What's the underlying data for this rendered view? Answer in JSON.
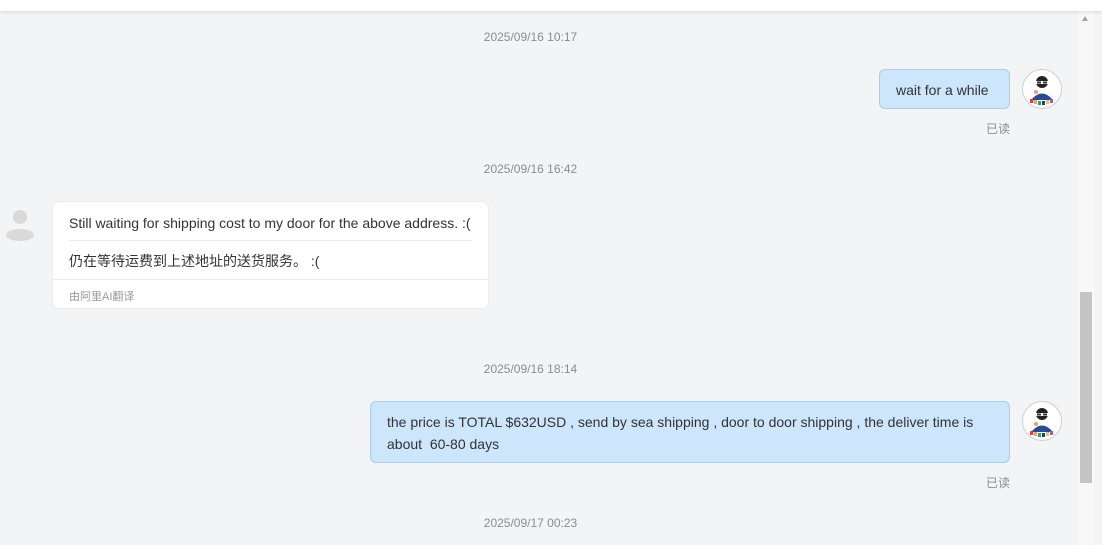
{
  "conversation": {
    "messages": [
      {
        "timestamp": "2025/09/16 10:17",
        "direction": "outgoing",
        "text": "wait for a while",
        "status": "已读"
      },
      {
        "timestamp": "2025/09/16 16:42",
        "direction": "incoming",
        "text": "Still waiting for shipping cost to my door for the above address. :(",
        "translation": "仍在等待运费到上述地址的送货服务。 :(",
        "translation_credit": "由阿里AI翻译"
      },
      {
        "timestamp": "2025/09/16 18:14",
        "direction": "outgoing",
        "text_line1": "the price is TOTAL $632USD , send by sea shipping , door to door shipping , the deliver time is",
        "text_line2": "about  60-80 days",
        "status": "已读"
      },
      {
        "timestamp": "2025/09/17 00:23"
      }
    ]
  },
  "avatars": {
    "me": "user-avatar-yunlai",
    "buyer": "default-user-avatar"
  },
  "colors": {
    "background": "#f3f4f6",
    "outgoing_bubble": "#cde6fb",
    "outgoing_border": "#a7cdef",
    "incoming_bubble": "#ffffff",
    "timestamp_text": "#8c8c8c"
  }
}
